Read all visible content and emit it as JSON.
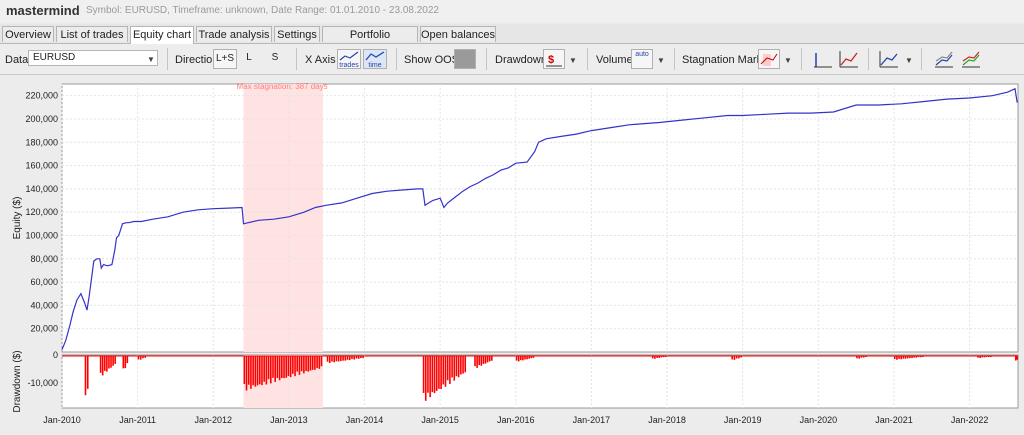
{
  "app": {
    "title": "mastermind",
    "subtitle": "Symbol: EURUSD, Timeframe: unknown, Date Range: 01.01.2010 - 23.08.2022"
  },
  "tabs": [
    {
      "label": "Overview"
    },
    {
      "label": "List of trades"
    },
    {
      "label": "Equity chart"
    },
    {
      "label": "Trade analysis"
    },
    {
      "label": "Settings"
    },
    {
      "label": "Portfolio correlation"
    },
    {
      "label": "Open balances"
    }
  ],
  "toolbar": {
    "data_label": "Data",
    "data_value": "EURUSD",
    "direction_label": "Direction",
    "direction_options": [
      "L+S",
      "L",
      "S"
    ],
    "xaxis_label": "X Axis",
    "xaxis_trades": "trades",
    "xaxis_time": "time",
    "show_oos_label": "Show OOS",
    "drawdown_label": "Drawdown",
    "volume_label": "Volume",
    "volume_auto": "auto",
    "stagnation_label": "Stagnation Marker"
  },
  "colors": {
    "equity": "#3333cc",
    "drawdown": "#ff0000",
    "stagnation": "#ffe2e2",
    "stagnation_text": "#ff8080"
  },
  "chart_data": {
    "type": "line",
    "stagnation_label": "Max stagnation: 387 days",
    "stagnation_range": [
      2012.4,
      2013.45
    ],
    "ylabel": "Equity ($)",
    "xlim": [
      2010.0,
      2022.64
    ],
    "ylim": [
      0,
      230000
    ],
    "yticks": [
      20000,
      40000,
      60000,
      80000,
      100000,
      120000,
      140000,
      160000,
      180000,
      200000,
      220000
    ],
    "ytick_labels": [
      "20,000",
      "40,000",
      "60,000",
      "80,000",
      "100,000",
      "120,000",
      "140,000",
      "160,000",
      "180,000",
      "200,000",
      "220,000"
    ],
    "xticks": [
      2010,
      2011,
      2012,
      2013,
      2014,
      2015,
      2016,
      2017,
      2018,
      2019,
      2020,
      2021,
      2022
    ],
    "xtick_labels": [
      "Jan-2010",
      "Jan-2011",
      "Jan-2012",
      "Jan-2013",
      "Jan-2014",
      "Jan-2015",
      "Jan-2016",
      "Jan-2017",
      "Jan-2018",
      "Jan-2019",
      "Jan-2020",
      "Jan-2021",
      "Jan-2022"
    ],
    "equity": {
      "x": [
        2010.0,
        2010.05,
        2010.1,
        2010.15,
        2010.2,
        2010.25,
        2010.3,
        2010.33,
        2010.36,
        2010.42,
        2010.46,
        2010.5,
        2010.52,
        2010.55,
        2010.6,
        2010.66,
        2010.7,
        2010.72,
        2010.75,
        2010.8,
        2010.85,
        2010.88,
        2010.95,
        2011.05,
        2011.2,
        2011.4,
        2011.6,
        2011.8,
        2012.0,
        2012.2,
        2012.38,
        2012.4,
        2012.6,
        2012.8,
        2013.0,
        2013.2,
        2013.35,
        2013.5,
        2013.7,
        2013.9,
        2014.1,
        2014.3,
        2014.5,
        2014.7,
        2014.77,
        2014.8,
        2014.9,
        2015.0,
        2015.05,
        2015.1,
        2015.2,
        2015.3,
        2015.4,
        2015.5,
        2015.6,
        2015.7,
        2015.8,
        2015.9,
        2016.0,
        2016.15,
        2016.25,
        2016.3,
        2016.4,
        2016.6,
        2016.8,
        2017.0,
        2017.3,
        2017.5,
        2017.7,
        2017.9,
        2018.2,
        2018.5,
        2018.8,
        2019.0,
        2019.3,
        2019.6,
        2019.9,
        2020.2,
        2020.5,
        2020.8,
        2021.1,
        2021.4,
        2021.7,
        2022.0,
        2022.3,
        2022.5,
        2022.6,
        2022.63
      ],
      "y": [
        2000,
        10000,
        22000,
        35000,
        45000,
        50000,
        42000,
        36000,
        48000,
        78000,
        80000,
        80000,
        72000,
        75000,
        74000,
        75000,
        88000,
        98000,
        100000,
        110000,
        111000,
        111000,
        112000,
        112000,
        114000,
        116000,
        120000,
        122000,
        123000,
        123500,
        124000,
        110000,
        113000,
        114000,
        116000,
        120000,
        124000,
        126000,
        128000,
        132000,
        136000,
        138000,
        139000,
        140000,
        140000,
        126000,
        130000,
        132000,
        124000,
        128000,
        133000,
        138000,
        142000,
        145000,
        149000,
        152000,
        156000,
        158000,
        162000,
        163000,
        172000,
        180000,
        183000,
        185000,
        187000,
        190000,
        193000,
        195000,
        196000,
        197000,
        199000,
        201000,
        203000,
        203000,
        204000,
        205000,
        205000,
        206000,
        212000,
        212000,
        213000,
        215000,
        217000,
        218000,
        220000,
        223000,
        226000,
        214000
      ]
    },
    "drawdown": {
      "ylabel": "Drawdown ($)",
      "ylim": [
        -19000,
        0
      ],
      "yticks": [
        0,
        -10000
      ],
      "ytick_labels": [
        "0",
        "-10,000"
      ],
      "segments": [
        {
          "x0": 2010.3,
          "x1": 2010.36,
          "depth": 18000
        },
        {
          "x0": 2010.5,
          "x1": 2010.72,
          "depth": 8000
        },
        {
          "x0": 2010.8,
          "x1": 2010.88,
          "depth": 6000
        },
        {
          "x0": 2011.0,
          "x1": 2011.12,
          "depth": 2000
        },
        {
          "x0": 2012.4,
          "x1": 2013.45,
          "depth": 13000
        },
        {
          "x0": 2013.5,
          "x1": 2014.0,
          "depth": 3000
        },
        {
          "x0": 2014.77,
          "x1": 2015.35,
          "depth": 17000
        },
        {
          "x0": 2015.45,
          "x1": 2015.7,
          "depth": 5000
        },
        {
          "x0": 2016.0,
          "x1": 2016.25,
          "depth": 2500
        },
        {
          "x0": 2017.8,
          "x1": 2018.0,
          "depth": 1500
        },
        {
          "x0": 2018.85,
          "x1": 2019.0,
          "depth": 2000
        },
        {
          "x0": 2020.5,
          "x1": 2020.65,
          "depth": 1500
        },
        {
          "x0": 2021.0,
          "x1": 2021.4,
          "depth": 1800
        },
        {
          "x0": 2022.1,
          "x1": 2022.3,
          "depth": 1200
        },
        {
          "x0": 2022.6,
          "x1": 2022.64,
          "depth": 2500
        }
      ]
    }
  }
}
